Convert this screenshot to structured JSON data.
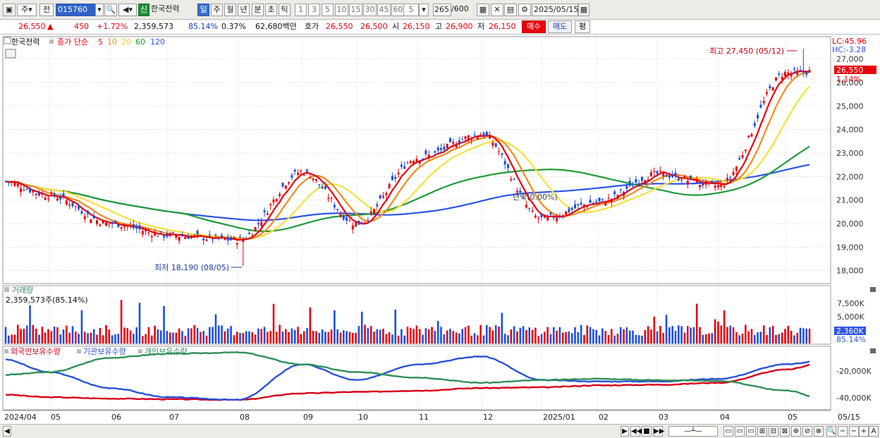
{
  "toolbar": {
    "period_button": "주",
    "prev_button": "전",
    "stock_code": "015760",
    "new_badge": "신",
    "stock_name": "한국전력",
    "tabs": [
      "일",
      "주",
      "월",
      "년",
      "분",
      "초",
      "틱"
    ],
    "intervals": [
      "1",
      "3",
      "5",
      "10",
      "15",
      "30",
      "45",
      "60"
    ],
    "interval_value": "5",
    "count_value": "265",
    "count_total": "/600",
    "date_value": "2025/05/15"
  },
  "quote": {
    "price": "26,550",
    "arrow": "▲",
    "change": "450",
    "change_pct": "+1.72%",
    "volume": "2,359,573",
    "volume_ratio": "85.14%",
    "turnover_rate": "0.37%",
    "amount": "62,680백만",
    "hoga_label": "호가",
    "ask": "26,550",
    "bid": "26,500",
    "open_label": "시",
    "open": "26,150",
    "high_label": "고",
    "high": "26,900",
    "low_label": "저",
    "low": "26,150",
    "buy_button": "매수",
    "sell_button": "매도",
    "eval_button": "평"
  },
  "price_panel": {
    "legend_name": "한국전력",
    "legend_label": "종가 단순",
    "legend_periods": [
      "5",
      "10",
      "20",
      "60",
      "120"
    ],
    "lc": "LC:45.96",
    "hc": "HC:-3.28",
    "current_price_tag": "26,550",
    "current_pct_tag": "1.14%",
    "max_annotation": "최고 27,450 (05/12)",
    "min_annotation": "최저 18,190 (08/05)",
    "mid_annotation": "단락(0.00%)"
  },
  "volume_panel": {
    "title": "거래량",
    "current": "2,359,573주(85.14%)",
    "tag": "2,360K",
    "tag_pct": "85.14%"
  },
  "holding_panel": {
    "legend": [
      "외국인보유수량",
      "기관보유수량",
      "개인보유수량"
    ]
  },
  "x_axis_labels": [
    "2024/04",
    "05",
    "06",
    "07",
    "08",
    "09",
    "10",
    "11",
    "12",
    "2025/01",
    "02",
    "03",
    "04",
    "05",
    "05/15"
  ],
  "colors": {
    "up": "#e8000c",
    "down": "#1b4fe0",
    "ma5": "#e8000c",
    "ma10": "#f08c1c",
    "ma20": "#f4e23a",
    "ma60": "#1f9a3a",
    "ma120": "#2d55e6",
    "foreign": "#d8001a",
    "institution": "#2a52d8",
    "individual": "#2f8f5a"
  },
  "chart_data": [
    {
      "type": "candlestick",
      "title": "한국전력",
      "y_ticks": [
        18000,
        19000,
        20000,
        21000,
        22000,
        23000,
        24000,
        25000,
        26000,
        27000
      ],
      "ylim": [
        17450,
        27950
      ],
      "price_points": [
        {
          "x": "2024/04",
          "y": 21800
        },
        {
          "x": "05",
          "y": 21200
        },
        {
          "x": "06",
          "y": 20000
        },
        {
          "x": "07",
          "y": 19500
        },
        {
          "x": "08",
          "y": 19300
        },
        {
          "x": "09",
          "y": 22200
        },
        {
          "x": "10",
          "y": 20000
        },
        {
          "x": "11",
          "y": 22800
        },
        {
          "x": "12",
          "y": 23800
        },
        {
          "x": "2025/01",
          "y": 20200
        },
        {
          "x": "02",
          "y": 20900
        },
        {
          "x": "03",
          "y": 22100
        },
        {
          "x": "04",
          "y": 21600
        },
        {
          "x": "05",
          "y": 26400
        },
        {
          "x": "05/15",
          "y": 26550
        }
      ],
      "series": [
        {
          "name": "5",
          "color": "#e8000c"
        },
        {
          "name": "10",
          "color": "#f08c1c"
        },
        {
          "name": "20",
          "color": "#f4e23a"
        },
        {
          "name": "60",
          "color": "#1f9a3a"
        },
        {
          "name": "120",
          "color": "#2d55e6"
        }
      ],
      "annotations": [
        {
          "text": "최고 27,450 (05/12)",
          "value": 27450
        },
        {
          "text": "최저 18,190 (08/05)",
          "value": 18190
        }
      ]
    },
    {
      "type": "bar",
      "title": "거래량",
      "y_ticks": [
        "7,500K",
        "5,000K"
      ],
      "ylim": [
        0,
        9000
      ],
      "last_value": 2360
    },
    {
      "type": "line",
      "title": "외국인보유수량 / 기관보유수량 / 개인보유수량",
      "y_ticks": [
        "-20,000K",
        "-40,000K"
      ],
      "series": [
        {
          "name": "외국인보유수량",
          "color": "#d8001a",
          "values": [
            -39000,
            -41000,
            -42000,
            -42500,
            -43000,
            -38000,
            -37000,
            -36000,
            -34000,
            -33500,
            -32000,
            -31500,
            -30000,
            -20000,
            -11500
          ]
        },
        {
          "name": "기관보유수량",
          "color": "#2a52d8",
          "values": [
            -12000,
            -22000,
            -34000,
            -41000,
            -43000,
            -16000,
            -28000,
            -16000,
            -10000,
            -28000,
            -29000,
            -29000,
            -27000,
            -16000,
            -11500
          ]
        },
        {
          "name": "개인보유수량",
          "color": "#2f8f5a",
          "values": [
            -24000,
            -22000,
            -11000,
            -8000,
            -7000,
            -16000,
            -22000,
            -26000,
            -30000,
            -28000,
            -27000,
            -28000,
            -28500,
            -36000,
            -46000
          ]
        }
      ]
    }
  ]
}
